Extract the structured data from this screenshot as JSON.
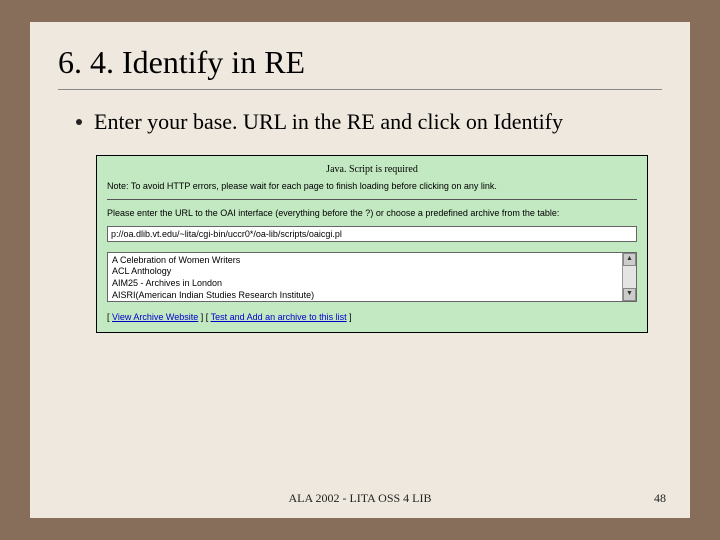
{
  "title": "6. 4. Identify in RE",
  "bullet_text": "Enter your base. URL in the RE and click on Identify",
  "embed": {
    "js_required": "Java. Script is required",
    "note": "Note: To avoid HTTP errors, please wait for each page to finish loading before clicking on any link.",
    "prompt": "Please enter the URL to the OAI interface (everything before the ?) or choose a predefined archive from the table:",
    "url_value": "p://oa.dlib.vt.edu/~lita/cgi-bin/uccr0*/oa-lib/scripts/oaicgi.pl",
    "options": [
      "A Celebration of Women Writers",
      "ACL Anthology",
      "AIM25 - Archives in London",
      "AISRI(American Indian Studies Research Institute)"
    ],
    "link_view": "View Archive Website",
    "link_test": "Test and Add an archive to this list"
  },
  "footer": "ALA 2002 - LITA OSS 4 LIB",
  "page_number": "48"
}
